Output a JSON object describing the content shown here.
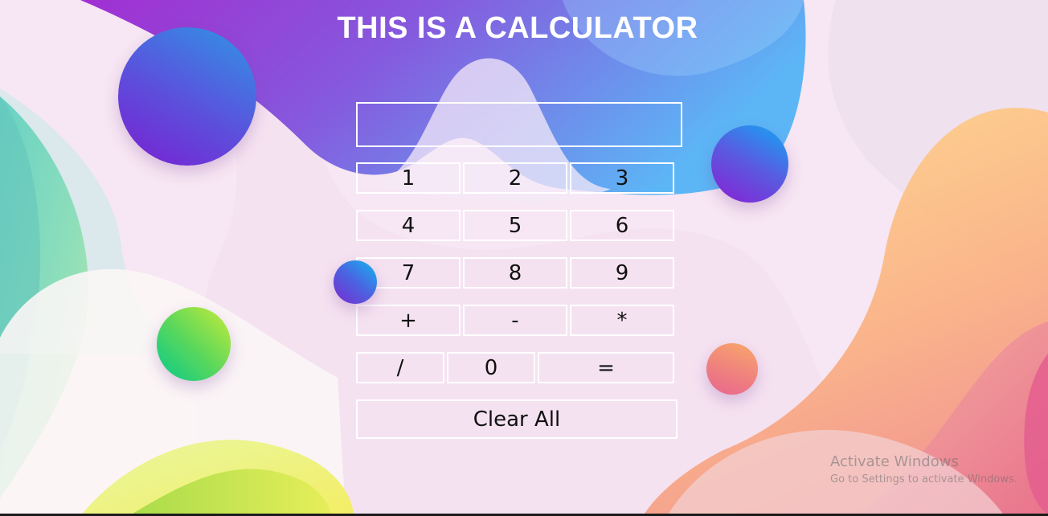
{
  "page": {
    "title": "THIS IS A CALCULATOR"
  },
  "calculator": {
    "display_value": "",
    "rows": [
      [
        "1",
        "2",
        "3"
      ],
      [
        "4",
        "5",
        "6"
      ],
      [
        "7",
        "8",
        "9"
      ],
      [
        "+",
        "-",
        "*"
      ],
      [
        "/",
        "0",
        "="
      ]
    ],
    "clear_label": "Clear All"
  },
  "watermark": {
    "title": "Activate Windows",
    "subtitle": "Go to Settings to activate Windows."
  },
  "colors": {
    "background": "#f7e6f3",
    "key_border": "#ffffff",
    "title_text": "#ffffff",
    "key_text": "#111111"
  }
}
